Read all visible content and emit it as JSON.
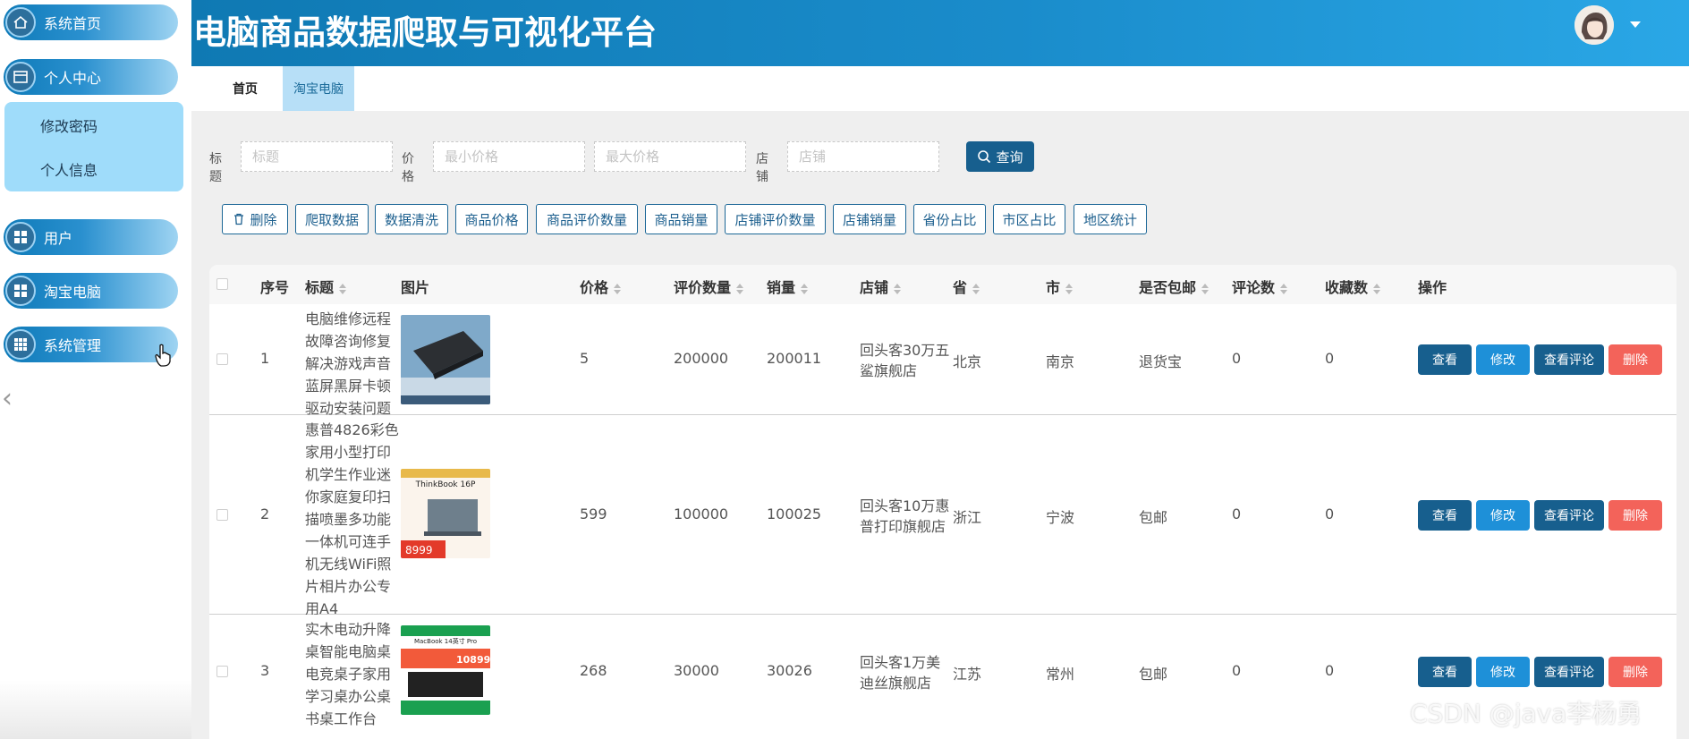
{
  "header": {
    "title": "电脑商品数据爬取与可视化平台"
  },
  "sidebar": {
    "items": [
      {
        "label": "系统首页",
        "icon": "home-icon"
      },
      {
        "label": "个人中心",
        "icon": "card-icon"
      },
      {
        "label": "用户",
        "icon": "grid-icon"
      },
      {
        "label": "淘宝电脑",
        "icon": "grid-icon"
      },
      {
        "label": "系统管理",
        "icon": "grid-icon"
      }
    ],
    "submenu": [
      "修改密码",
      "个人信息"
    ]
  },
  "tabs": [
    "首页",
    "淘宝电脑"
  ],
  "search": {
    "title_label": "标题",
    "title_placeholder": "标题",
    "price_label": "价格",
    "min_price_placeholder": "最小价格",
    "max_price_placeholder": "最大价格",
    "shop_label": "店铺",
    "shop_placeholder": "店铺",
    "query_label": "查询"
  },
  "actions": [
    "删除",
    "爬取数据",
    "数据清洗",
    "商品价格",
    "商品评价数量",
    "商品销量",
    "店铺评价数量",
    "店铺销量",
    "省份占比",
    "市区占比",
    "地区统计"
  ],
  "table": {
    "columns": [
      "序号",
      "标题",
      "图片",
      "价格",
      "评价数量",
      "销量",
      "店铺",
      "省",
      "市",
      "是否包邮",
      "评论数",
      "收藏数",
      "操作"
    ],
    "rows": [
      {
        "index": "1",
        "title": "电脑维修远程故障咨询修复解决游戏声音蓝屏黑屏卡顿驱动安装问题",
        "price": "5",
        "reviews": "200000",
        "sales": "200011",
        "shop": "回头客30万五鲨旗舰店",
        "province": "北京",
        "city": "南京",
        "shipping": "退货宝",
        "comments": "0",
        "favorites": "0"
      },
      {
        "index": "2",
        "title": "惠普4826彩色家用小型打印机学生作业迷你家庭复印扫描喷墨多功能一体机可连手机无线WiFi照片相片办公专用A4",
        "price": "599",
        "reviews": "100000",
        "sales": "100025",
        "shop": "回头客10万惠普打印旗舰店",
        "province": "浙江",
        "city": "宁波",
        "shipping": "包邮",
        "comments": "0",
        "favorites": "0"
      },
      {
        "index": "3",
        "title": "实木电动升降桌智能电脑桌电竞桌子家用学习桌办公桌书桌工作台",
        "price": "268",
        "reviews": "30000",
        "sales": "30026",
        "shop": "回头客1万美迪丝旗舰店",
        "province": "江苏",
        "city": "常州",
        "shipping": "包邮",
        "comments": "0",
        "favorites": "0"
      }
    ],
    "row_ops": [
      "查看",
      "修改",
      "查看评论",
      "删除"
    ],
    "thumb_texts": {
      "row2_model": "ThinkBook 16P",
      "row2_price": "8999",
      "row3_model": "MacBook 14英寸 Pro",
      "row3_price": "10899"
    }
  },
  "watermark": "CSDN @java李杨勇",
  "colors": {
    "primary": "#175f8e",
    "accent": "#1e90d8",
    "danger": "#f3635a",
    "header": "#1a8ccb"
  }
}
